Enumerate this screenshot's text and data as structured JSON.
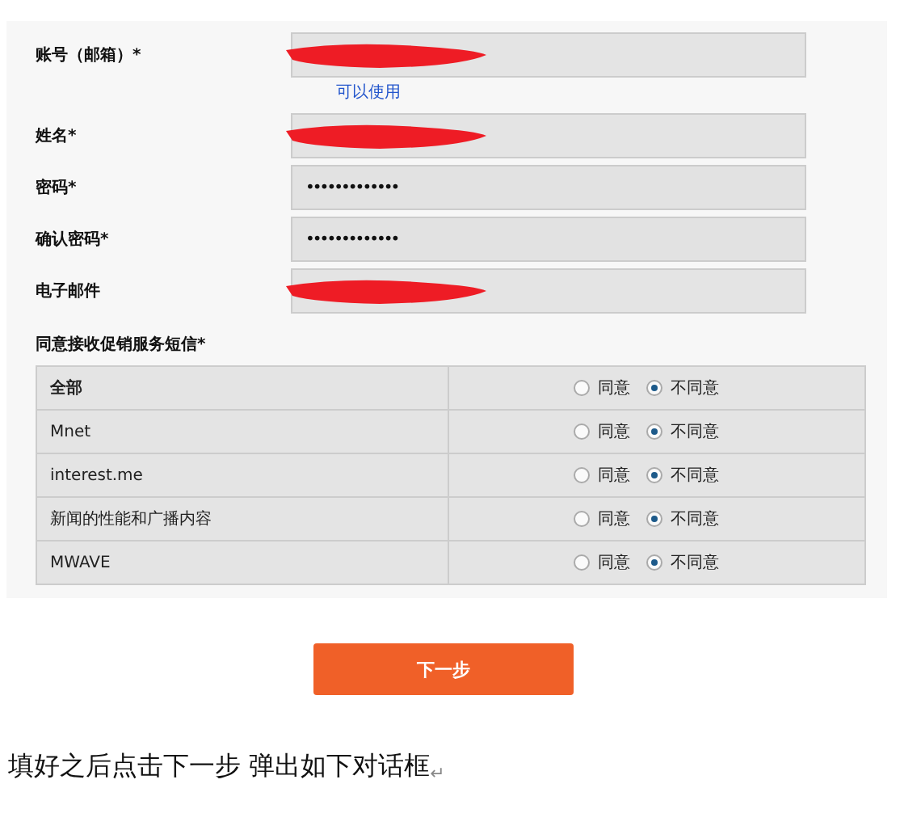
{
  "form": {
    "fields": [
      {
        "label": "账号（邮箱）*",
        "kind": "text",
        "redacted": true,
        "hint": "可以使用"
      },
      {
        "label": "姓名*",
        "kind": "text",
        "redacted": true
      },
      {
        "label": "密码*",
        "kind": "password",
        "value": "•••••••••••••"
      },
      {
        "label": "确认密码*",
        "kind": "password",
        "value": "•••••••••••••"
      },
      {
        "label": "电子邮件",
        "kind": "text",
        "redacted": true
      }
    ],
    "consent": {
      "label": "同意接收促销服务短信*",
      "rows": [
        {
          "name": "全部",
          "kind": "all",
          "options": [
            {
              "label": "同意",
              "selected": false
            },
            {
              "label": "不同意",
              "selected": true
            }
          ]
        },
        {
          "name": "Mnet",
          "kind": "item",
          "options": [
            {
              "label": "同意",
              "selected": false
            },
            {
              "label": "不同意",
              "selected": true
            }
          ]
        },
        {
          "name": "interest.me",
          "kind": "item",
          "options": [
            {
              "label": "同意",
              "selected": false
            },
            {
              "label": "不同意",
              "selected": true
            }
          ]
        },
        {
          "name": "新闻的性能和广播内容",
          "kind": "item",
          "options": [
            {
              "label": "同意",
              "selected": false
            },
            {
              "label": "不同意",
              "selected": true
            }
          ]
        },
        {
          "name": "MWAVE",
          "kind": "item",
          "options": [
            {
              "label": "同意",
              "selected": false
            },
            {
              "label": "不同意",
              "selected": true
            }
          ]
        }
      ]
    },
    "next_button": "下一步"
  },
  "caption": {
    "text": "填好之后点击下一步  弹出如下对话框",
    "paragraph_mark": "↵"
  }
}
